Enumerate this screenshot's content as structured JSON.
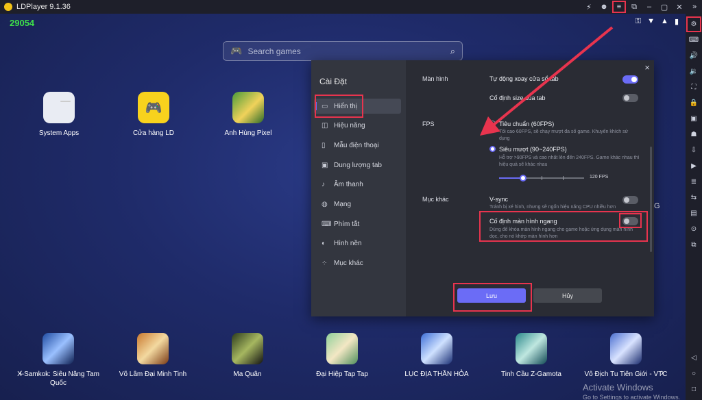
{
  "titlebar": {
    "title": "LDPlayer 9.1.36",
    "controls": [
      "⚡",
      "☻",
      "≡",
      "⧉",
      "–",
      "▢",
      "✕",
      "»"
    ]
  },
  "status": {
    "left": "29054",
    "right": [
      "⚿",
      "▼",
      "▲",
      "▮"
    ]
  },
  "search": {
    "placeholder": "Search games"
  },
  "top_apps": [
    {
      "label": "System Apps"
    },
    {
      "label": "Cửa hàng LD"
    },
    {
      "label": "Anh Hùng Pixel"
    }
  ],
  "bottom_apps": [
    {
      "label": "X-Samkok: Siêu Năng Tam Quốc"
    },
    {
      "label": "Võ Lâm Đại Minh Tinh"
    },
    {
      "label": "Ma Quân"
    },
    {
      "label": "Đại Hiệp Tap Tap"
    },
    {
      "label": "LỤC ĐỊA THẦN HỎA"
    },
    {
      "label": "Tinh Cầu Z-Gamota"
    },
    {
      "label": "Vô Địch Tu Tiên Giới - VTC"
    }
  ],
  "desktop_partial": "G",
  "watermark": {
    "line1": "Activate Windows",
    "line2": "Go to Settings to activate Windows."
  },
  "settings": {
    "title": "Cài Đặt",
    "nav": [
      {
        "label": "Hiển thị",
        "icon": "▭"
      },
      {
        "label": "Hiệu năng",
        "icon": "◫"
      },
      {
        "label": "Mẫu điện thoại",
        "icon": "▯"
      },
      {
        "label": "Dung lượng tab",
        "icon": "▣"
      },
      {
        "label": "Âm thanh",
        "icon": "♪"
      },
      {
        "label": "Mạng",
        "icon": "◍"
      },
      {
        "label": "Phím tắt",
        "icon": "⌨"
      },
      {
        "label": "Hình nền",
        "icon": "◐"
      },
      {
        "label": "Mục khác",
        "icon": "⁘"
      }
    ],
    "screen": {
      "label": "Màn hình",
      "auto_rotate": "Tự động xoay cửa sổ tab",
      "auto_rotate_on": true,
      "fixed_size": "Cố định size của tab",
      "fixed_size_on": false
    },
    "fps": {
      "label": "FPS",
      "standard": "Tiêu chuẩn (60FPS)",
      "standard_desc": "Tối cao 60FPS, sẽ chạy mượt đa số game. Khuyến khích sử dụng",
      "smooth": "Siêu mượt (90~240FPS)",
      "smooth_desc": "Hỗ trợ >90FPS và cao nhất lên đến 240FPS. Game khác nhau thì hiệu quả sẽ khác nhau",
      "selected": "smooth",
      "slider_value": "120 FPS",
      "slider_fraction": 0.28
    },
    "other": {
      "label": "Mục khác",
      "vsync": "V-sync",
      "vsync_desc": "Tránh bị xé hình, nhưng sẽ ngốn hiệu năng CPU nhiều hơn",
      "vsync_on": false,
      "fixed_landscape": "Cố định màn hình ngang",
      "fixed_landscape_desc": "Dùng để khóa màn hình ngang cho game hoặc ứng dụng màn hình dọc, cho nó khớp màn hình hơn",
      "fixed_landscape_on": false
    },
    "buttons": {
      "save": "Lưu",
      "cancel": "Hủy"
    }
  },
  "colors": {
    "accent": "#6b6cf6",
    "highlight": "#e8344e",
    "desktop": "#1f2b6a"
  }
}
